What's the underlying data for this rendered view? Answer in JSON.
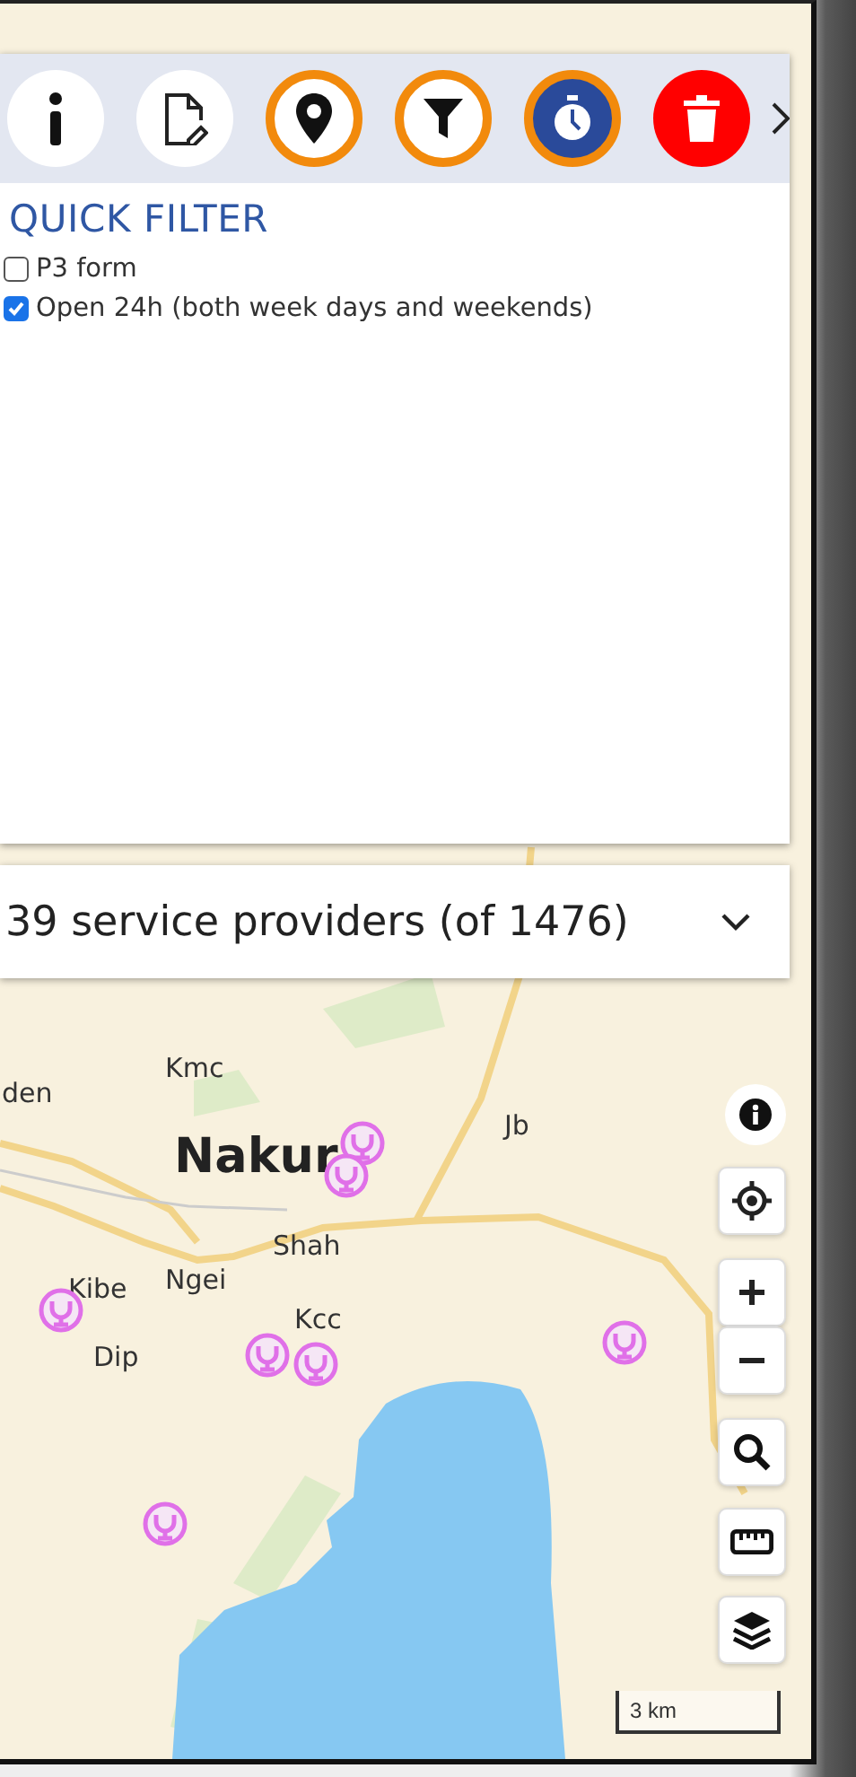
{
  "toolbar": {
    "buttons": [
      {
        "kind": "info",
        "active": false
      },
      {
        "kind": "edit",
        "active": false
      },
      {
        "kind": "location",
        "active": true
      },
      {
        "kind": "filter",
        "active": true
      },
      {
        "kind": "timer",
        "active": true
      },
      {
        "kind": "delete",
        "active": false
      }
    ]
  },
  "quick_filter": {
    "title": "QUICK FILTER",
    "options": [
      {
        "label": "P3 form",
        "checked": false
      },
      {
        "label": "Open 24h (both week days and weekends)",
        "checked": true
      }
    ]
  },
  "results": {
    "summary": "39 service providers (of 1476)",
    "expanded": false
  },
  "map": {
    "place_labels": [
      {
        "text": "den",
        "kind": "small"
      },
      {
        "text": "Kmc",
        "kind": "small"
      },
      {
        "text": "Nakur",
        "kind": "city"
      },
      {
        "text": "Jb",
        "kind": "small"
      },
      {
        "text": "Shah",
        "kind": "small"
      },
      {
        "text": "Ngei",
        "kind": "small"
      },
      {
        "text": "Kibe",
        "kind": "small"
      },
      {
        "text": "Dip",
        "kind": "small"
      },
      {
        "text": "Kcc",
        "kind": "small"
      }
    ],
    "scale": "3 km"
  }
}
